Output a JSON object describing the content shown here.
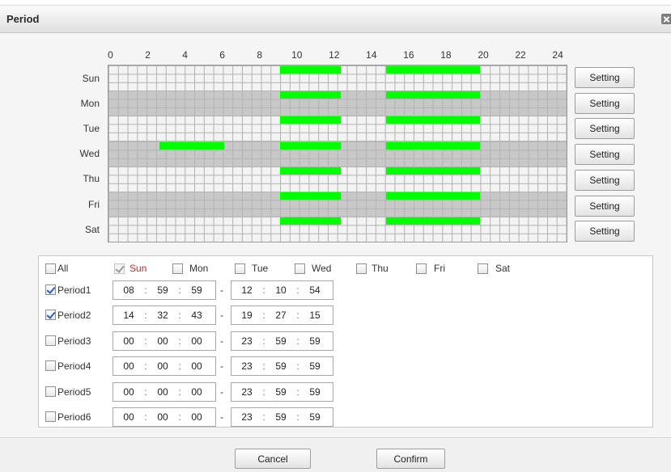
{
  "dialog": {
    "title": "Period",
    "close_icon": "close-icon"
  },
  "schedule": {
    "hour_labels": [
      "0",
      "2",
      "4",
      "6",
      "8",
      "10",
      "12",
      "14",
      "16",
      "18",
      "20",
      "22",
      "24"
    ],
    "hour_range": [
      0,
      24
    ],
    "bar_color": "#00ff00",
    "days": [
      {
        "label": "Sun",
        "setting_label": "Setting",
        "periods_hours": [
          [
            9.0,
            12.18
          ],
          [
            14.55,
            19.45
          ]
        ]
      },
      {
        "label": "Mon",
        "setting_label": "Setting",
        "periods_hours": [
          [
            9.0,
            12.18
          ],
          [
            14.55,
            19.45
          ]
        ]
      },
      {
        "label": "Tue",
        "setting_label": "Setting",
        "periods_hours": [
          [
            9.0,
            12.18
          ],
          [
            14.55,
            19.45
          ]
        ]
      },
      {
        "label": "Wed",
        "setting_label": "Setting",
        "periods_hours": [
          [
            2.67,
            6.07
          ],
          [
            9.0,
            12.18
          ],
          [
            14.55,
            19.45
          ]
        ]
      },
      {
        "label": "Thu",
        "setting_label": "Setting",
        "periods_hours": [
          [
            9.0,
            12.18
          ],
          [
            14.55,
            19.45
          ]
        ]
      },
      {
        "label": "Fri",
        "setting_label": "Setting",
        "periods_hours": [
          [
            9.0,
            12.18
          ],
          [
            14.55,
            19.45
          ]
        ]
      },
      {
        "label": "Sat",
        "setting_label": "Setting",
        "periods_hours": [
          [
            9.0,
            12.18
          ],
          [
            14.55,
            19.45
          ]
        ]
      }
    ]
  },
  "day_selector": {
    "all": {
      "label": "All",
      "checked": false
    },
    "selected_day_color": "#e02020",
    "days": [
      {
        "label": "Sun",
        "checked": true,
        "disabled": true
      },
      {
        "label": "Mon",
        "checked": false
      },
      {
        "label": "Tue",
        "checked": false
      },
      {
        "label": "Wed",
        "checked": false
      },
      {
        "label": "Thu",
        "checked": false
      },
      {
        "label": "Fri",
        "checked": false
      },
      {
        "label": "Sat",
        "checked": false
      }
    ]
  },
  "time_separator": ":",
  "range_separator": "-",
  "periods": [
    {
      "label": "Period1",
      "checked": true,
      "start": {
        "h": "08",
        "m": "59",
        "s": "59"
      },
      "end": {
        "h": "12",
        "m": "10",
        "s": "54"
      }
    },
    {
      "label": "Period2",
      "checked": true,
      "start": {
        "h": "14",
        "m": "32",
        "s": "43"
      },
      "end": {
        "h": "19",
        "m": "27",
        "s": "15"
      }
    },
    {
      "label": "Period3",
      "checked": false,
      "start": {
        "h": "00",
        "m": "00",
        "s": "00"
      },
      "end": {
        "h": "23",
        "m": "59",
        "s": "59"
      }
    },
    {
      "label": "Period4",
      "checked": false,
      "start": {
        "h": "00",
        "m": "00",
        "s": "00"
      },
      "end": {
        "h": "23",
        "m": "59",
        "s": "59"
      }
    },
    {
      "label": "Period5",
      "checked": false,
      "start": {
        "h": "00",
        "m": "00",
        "s": "00"
      },
      "end": {
        "h": "23",
        "m": "59",
        "s": "59"
      }
    },
    {
      "label": "Period6",
      "checked": false,
      "start": {
        "h": "00",
        "m": "00",
        "s": "00"
      },
      "end": {
        "h": "23",
        "m": "59",
        "s": "59"
      }
    }
  ],
  "footer": {
    "cancel_label": "Cancel",
    "confirm_label": "Confirm"
  }
}
